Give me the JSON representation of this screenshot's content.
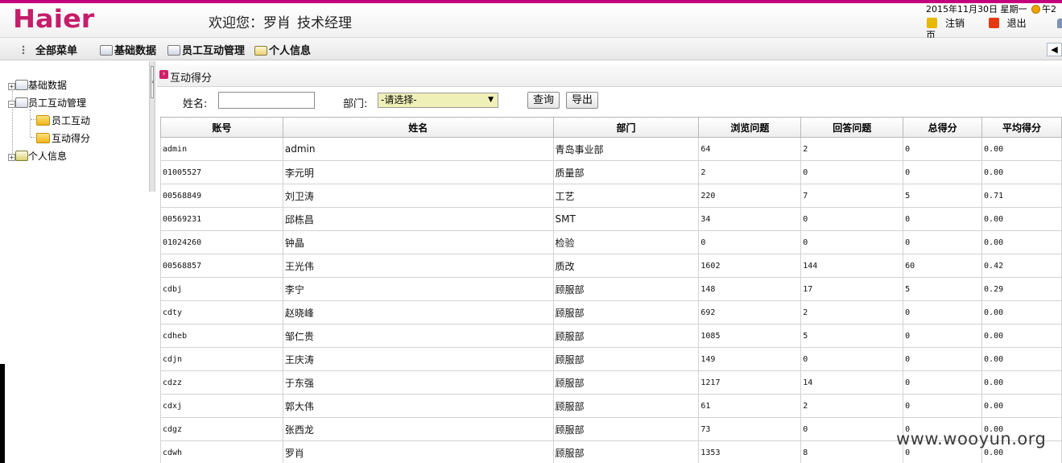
{
  "header": {
    "logo": "Haier",
    "welcome_prefix": "欢迎您：",
    "user_name": "罗肖",
    "user_title": "技术经理",
    "date_line": "2015年11月30日 星期一",
    "time_text": "午2",
    "logout_label": "注销",
    "exit_label": "退出",
    "page_label": "页"
  },
  "menubar": {
    "all_menu": "全部菜单",
    "items": [
      "基础数据",
      "员工互动管理",
      "个人信息"
    ],
    "collapse_glyph": "◀"
  },
  "sidebar": {
    "tree": [
      {
        "label": "基础数据",
        "expanded": false
      },
      {
        "label": "员工互动管理",
        "expanded": true,
        "children": [
          "员工互动",
          "互动得分"
        ]
      },
      {
        "label": "个人信息",
        "expanded": false
      }
    ]
  },
  "content": {
    "title": "互动得分",
    "filter": {
      "name_label": "姓名:",
      "name_value": "",
      "dept_label": "部门:",
      "dept_selected": "-请选择-",
      "query_button": "查询",
      "export_button": "导出"
    },
    "table": {
      "columns": [
        "账号",
        "姓名",
        "部门",
        "浏览问题",
        "回答问题",
        "总得分",
        "平均得分"
      ],
      "rows": [
        [
          "admin",
          "admin",
          "青岛事业部",
          "64",
          "2",
          "0",
          "0.00"
        ],
        [
          "01005527",
          "李元明",
          "质量部",
          "2",
          "0",
          "0",
          "0.00"
        ],
        [
          "00568849",
          "刘卫涛",
          "工艺",
          "220",
          "7",
          "5",
          "0.71"
        ],
        [
          "00569231",
          "邱栋昌",
          "SMT",
          "34",
          "0",
          "0",
          "0.00"
        ],
        [
          "01024260",
          "钟晶",
          "检验",
          "0",
          "0",
          "0",
          "0.00"
        ],
        [
          "00568857",
          "王光伟",
          "质改",
          "1602",
          "144",
          "60",
          "0.42"
        ],
        [
          "cdbj",
          "李宁",
          "顾服部",
          "148",
          "17",
          "5",
          "0.29"
        ],
        [
          "cdty",
          "赵晓峰",
          "顾服部",
          "692",
          "2",
          "0",
          "0.00"
        ],
        [
          "cdheb",
          "邹仁贵",
          "顾服部",
          "1085",
          "5",
          "0",
          "0.00"
        ],
        [
          "cdjn",
          "王庆涛",
          "顾服部",
          "149",
          "0",
          "0",
          "0.00"
        ],
        [
          "cdzz",
          "于东强",
          "顾服部",
          "1217",
          "14",
          "0",
          "0.00"
        ],
        [
          "cdxj",
          "郭大伟",
          "顾服部",
          "61",
          "2",
          "0",
          "0.00"
        ],
        [
          "cdgz",
          "张西龙",
          "顾服部",
          "73",
          "0",
          "0",
          "0.00"
        ],
        [
          "cdwh",
          "罗肖",
          "顾服部",
          "1353",
          "8",
          "0",
          "0.00"
        ]
      ]
    }
  },
  "watermark": "www.wooyun.org",
  "colors": {
    "brand": "#c51d6a",
    "accent_border": "#c4007a",
    "select_bg": "#eff0b8"
  }
}
